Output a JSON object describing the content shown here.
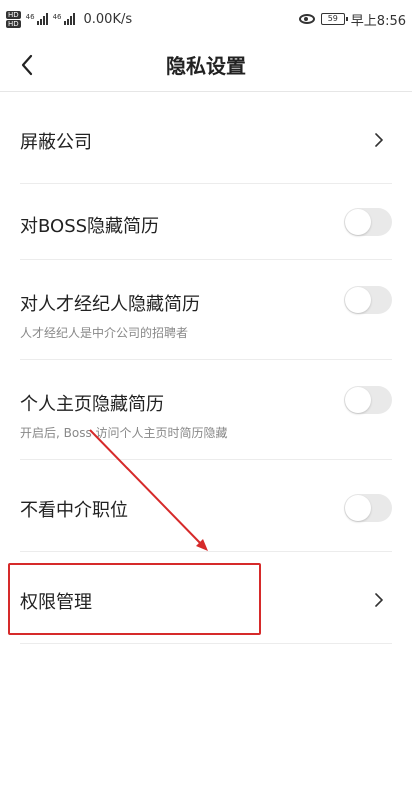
{
  "status_bar": {
    "hd1": "HD",
    "hd2": "HD",
    "sig1_tag": "46",
    "sig2_tag": "46",
    "network_speed": "0.00K/s",
    "battery": "59",
    "time": "早上8:56",
    "icons": [
      "eye-comfort-icon",
      "battery-icon"
    ]
  },
  "header": {
    "title": "隐私设置",
    "back_icon": "back-chevron-icon"
  },
  "settings": [
    {
      "label": "屏蔽公司",
      "type": "link"
    },
    {
      "label": "对BOSS隐藏简历",
      "type": "toggle",
      "on": false
    },
    {
      "label": "对人才经纪人隐藏简历",
      "desc": "人才经纪人是中介公司的招聘者",
      "type": "toggle",
      "on": false
    },
    {
      "label": "个人主页隐藏简历",
      "desc": "开启后, Boss 访问个人主页时简历隐藏",
      "type": "toggle",
      "on": false
    },
    {
      "label": "不看中介职位",
      "type": "toggle",
      "on": false
    },
    {
      "label": "权限管理",
      "type": "link"
    }
  ],
  "colors": {
    "accent_annotation": "#d62a2a",
    "toggle_off": "#e9e9e9",
    "divider": "#ececec"
  }
}
